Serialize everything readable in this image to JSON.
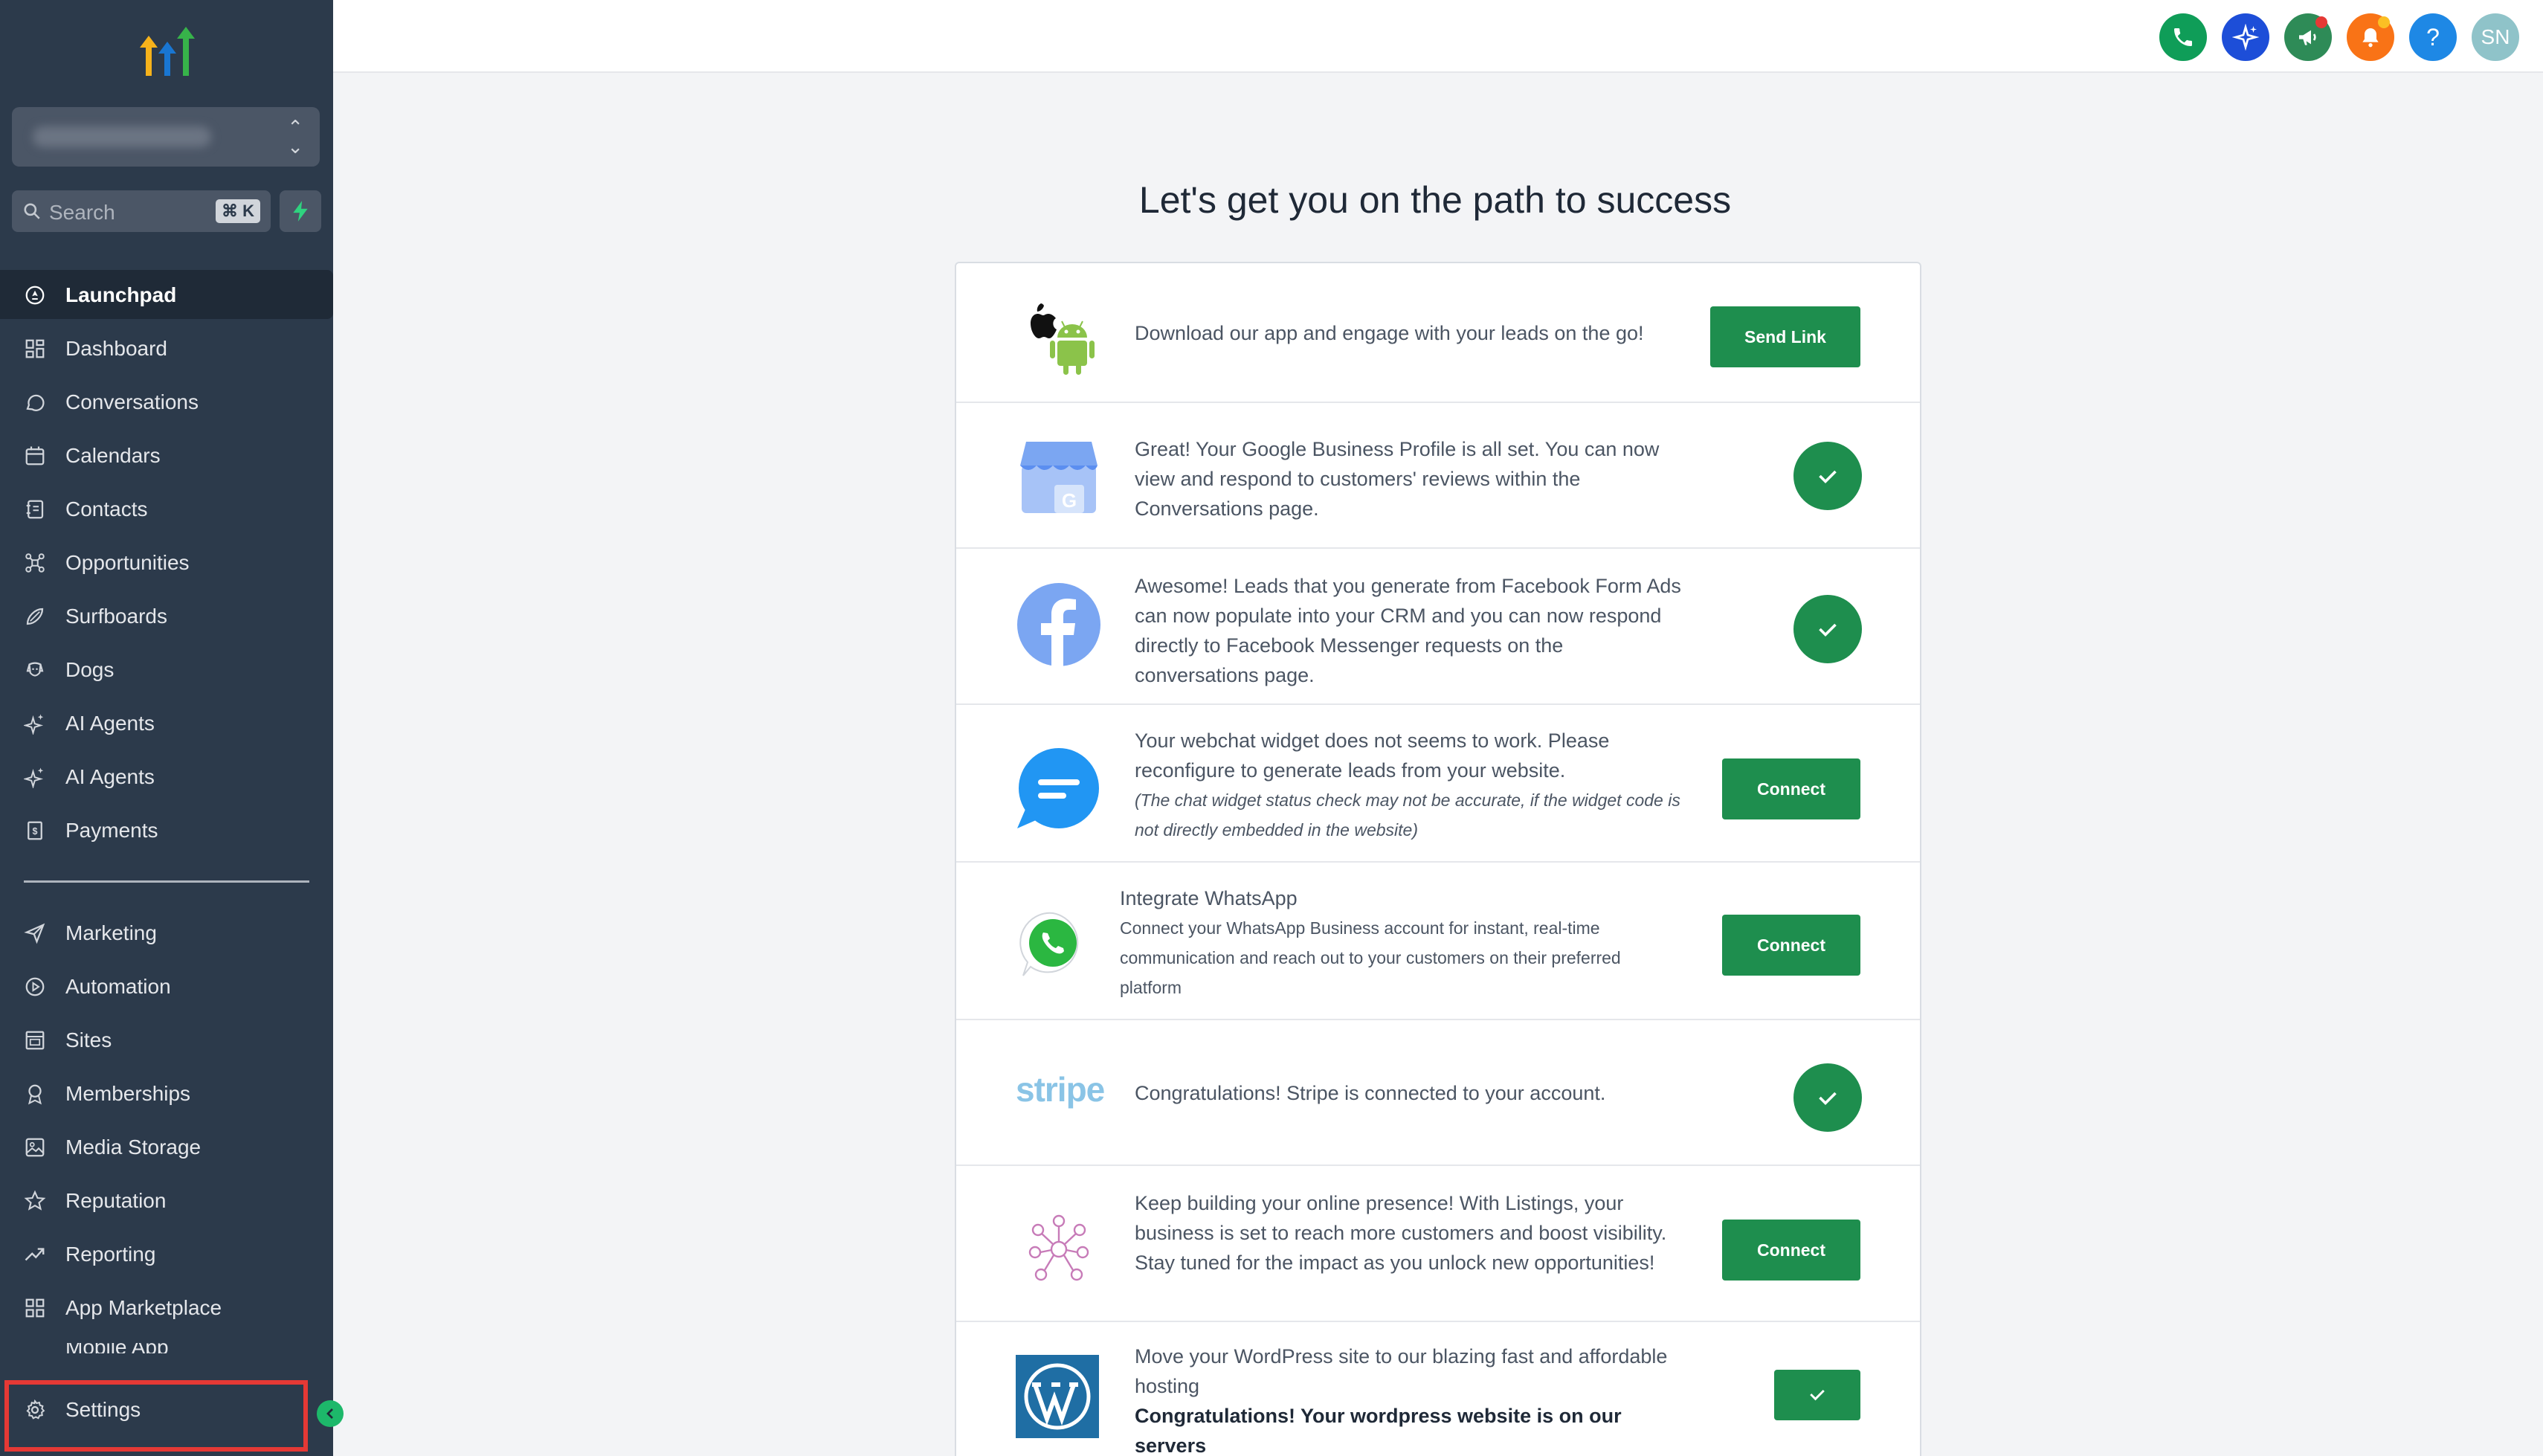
{
  "sidebar": {
    "search_placeholder": "Search",
    "search_shortcut": "⌘ K",
    "items_main": [
      {
        "label": "Launchpad",
        "icon": "launchpad-icon",
        "active": true
      },
      {
        "label": "Dashboard",
        "icon": "dashboard-icon"
      },
      {
        "label": "Conversations",
        "icon": "chat-bubble-icon"
      },
      {
        "label": "Calendars",
        "icon": "calendar-icon"
      },
      {
        "label": "Contacts",
        "icon": "contacts-icon"
      },
      {
        "label": "Opportunities",
        "icon": "opportunities-icon"
      },
      {
        "label": "Surfboards",
        "icon": "surfboard-icon"
      },
      {
        "label": "Dogs",
        "icon": "dog-icon"
      },
      {
        "label": "AI Agents",
        "icon": "sparkle-icon"
      },
      {
        "label": "AI Agents",
        "icon": "sparkle-icon"
      },
      {
        "label": "Payments",
        "icon": "payments-icon"
      }
    ],
    "items_secondary": [
      {
        "label": "Marketing",
        "icon": "send-icon"
      },
      {
        "label": "Automation",
        "icon": "automation-icon"
      },
      {
        "label": "Sites",
        "icon": "sites-icon"
      },
      {
        "label": "Memberships",
        "icon": "membership-icon"
      },
      {
        "label": "Media Storage",
        "icon": "image-icon"
      },
      {
        "label": "Reputation",
        "icon": "star-icon"
      },
      {
        "label": "Reporting",
        "icon": "trend-icon"
      },
      {
        "label": "App Marketplace",
        "icon": "grid-icon"
      }
    ],
    "partial_item": "Mobile App",
    "settings_label": "Settings"
  },
  "topbar": {
    "buttons": [
      {
        "icon": "phone-icon",
        "color": "#0f9d58"
      },
      {
        "icon": "ai-sparkle-icon",
        "color": "#1d4ed8"
      },
      {
        "icon": "megaphone-icon",
        "color": "#2e8b57"
      },
      {
        "icon": "bell-icon",
        "color": "#f97316"
      },
      {
        "icon": "help-icon",
        "color": "#1e88e5"
      }
    ],
    "avatar_initials": "SN",
    "help_glyph": "?"
  },
  "main": {
    "title": "Let's get you on the path to success",
    "rows": [
      {
        "icon": "app-store-icon",
        "text": "Download our app and engage with your leads on the go!",
        "action": "button",
        "action_label": "Send Link"
      },
      {
        "icon": "google-business-icon",
        "text": "Great! Your Google Business Profile is all set. You can now view and respond to customers' reviews within the Conversations page.",
        "action": "check"
      },
      {
        "icon": "facebook-icon",
        "text": "Awesome! Leads that you generate from Facebook Form Ads can now populate into your CRM and you can now respond directly to Facebook Messenger requests on the conversations page.",
        "action": "check"
      },
      {
        "icon": "webchat-icon",
        "text": "Your webchat widget does not seems to work. Please reconfigure to generate leads from your website.",
        "note": "(The chat widget status check may not be accurate, if the widget code is not directly embedded in the website)",
        "action": "button",
        "action_label": "Connect"
      },
      {
        "icon": "whatsapp-icon",
        "title": "Integrate WhatsApp",
        "text": "Connect your WhatsApp Business account for instant, real-time communication and reach out to your customers on their preferred platform",
        "action": "button",
        "action_label": "Connect"
      },
      {
        "icon": "stripe-icon",
        "logo_text": "stripe",
        "text": "Congratulations! Stripe is connected to your account.",
        "action": "check"
      },
      {
        "icon": "listings-icon",
        "text": "Keep building your online presence! With Listings, your business is set to reach more customers and boost visibility. Stay tuned for the impact as you unlock new opportunities!",
        "action": "button",
        "action_label": "Connect"
      },
      {
        "icon": "wordpress-icon",
        "text": "Move your WordPress site to our blazing fast and affordable hosting",
        "bold_text": "Congratulations! Your wordpress website is on our servers",
        "action": "check-button"
      }
    ]
  }
}
